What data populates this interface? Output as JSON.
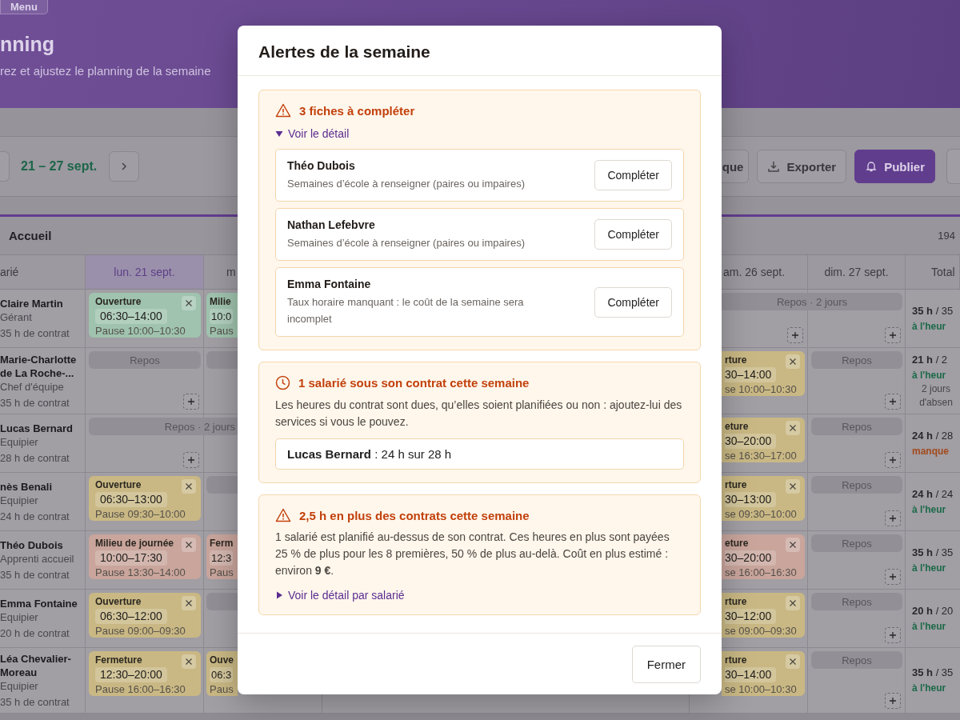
{
  "page": {
    "menu_button": "Menu",
    "title": "nning",
    "subtitle": "rez et ajustez le planning de la semaine"
  },
  "toolbar": {
    "week": "21 – 27 sept.",
    "buttons": [
      {
        "kind": "plain",
        "label": "que"
      },
      {
        "kind": "export",
        "label": "Exporter"
      },
      {
        "kind": "primary",
        "label": "Publier"
      }
    ]
  },
  "team": {
    "name": "Accueil",
    "total": "194"
  },
  "table": {
    "employee_header": "arié",
    "total_header": "Total",
    "columns": [
      {
        "label": "lun. 21 sept.",
        "selected": true
      },
      {
        "label": "m",
        "selected": false
      },
      {
        "label": "am. 26 sept.",
        "selected": false
      },
      {
        "label": "dim. 27 sept.",
        "selected": false
      }
    ],
    "rows": [
      {
        "name": "Claire Martin",
        "role": "Gérant",
        "contract": "35 h de contrat",
        "cells": [
          {
            "kind": "shift",
            "color": "#9fc3ae",
            "title": "Ouverture",
            "time": "06:30–14:00",
            "pause": "Pause 10:00–10:30"
          },
          {
            "kind": "shift",
            "color": "#9fc3ae",
            "title": "Milie",
            "time": "10:0",
            "pause": "Paus"
          },
          {
            "kind": "rest_span",
            "label": "Repos · 2 jours"
          },
          {
            "kind": "rest_cont"
          }
        ],
        "total": {
          "hours": "**35 h** / 35",
          "status": "à l'heur",
          "ok": true
        }
      },
      {
        "name": "Marie-Charlotte de La Roche-...",
        "role": "Chef d'équipe",
        "contract": "35 h de contrat",
        "cells": [
          {
            "kind": "rest",
            "label": "Repos"
          },
          {
            "kind": "blank_rest"
          },
          {
            "kind": "shift",
            "color": "#c9b884",
            "title": "rture",
            "time": "30–14:00",
            "pause": "se 10:00–10:30"
          },
          {
            "kind": "rest",
            "label": "Repos"
          }
        ],
        "total": {
          "hours": "**21 h** / 2",
          "status": "à l'heur",
          "ok": true,
          "note": "2 jours d'absen"
        }
      },
      {
        "name": "Lucas Bernard",
        "role": "Equipier",
        "contract": "28 h de contrat",
        "cells": [
          {
            "kind": "rest_span",
            "label": "Repos · 2 jours"
          },
          {
            "kind": "rest_cont"
          },
          {
            "kind": "shift",
            "color": "#c9b884",
            "title": "eture",
            "time": "30–20:00",
            "pause": "se 16:30–17:00"
          },
          {
            "kind": "rest",
            "label": "Repos"
          }
        ],
        "total": {
          "hours": "**24 h** / 28",
          "status": "manque",
          "ok": false
        }
      },
      {
        "name": "nès Benali",
        "role": "Equipier",
        "contract": "24 h de contrat",
        "cells": [
          {
            "kind": "shift",
            "color": "#c9b884",
            "title": "Ouverture",
            "time": "06:30–13:00",
            "pause": "Pause 09:30–10:00"
          },
          {
            "kind": "blank_rest"
          },
          {
            "kind": "shift",
            "color": "#c9b884",
            "title": "rture",
            "time": "30–13:00",
            "pause": "se 09:30–10:00"
          },
          {
            "kind": "rest",
            "label": "Repos"
          }
        ],
        "total": {
          "hours": "**24 h** / 24",
          "status": "à l'heur",
          "ok": true
        }
      },
      {
        "name": "Théo Dubois",
        "role": "Apprenti accueil",
        "contract": "35 h de contrat",
        "cells": [
          {
            "kind": "shift",
            "color": "#c9a59c",
            "title": "Milieu de journée",
            "time": "10:00–17:30",
            "pause": "Pause 13:30–14:00"
          },
          {
            "kind": "shift",
            "color": "#c9a59c",
            "title": "Ferm",
            "time": "12:3",
            "pause": "Paus"
          },
          {
            "kind": "shift",
            "color": "#c9a59c",
            "title": "eture",
            "time": "30–20:00",
            "pause": "se 16:00–16:30"
          },
          {
            "kind": "rest",
            "label": "Repos"
          }
        ],
        "total": {
          "hours": "**35 h** / 35",
          "status": "à l'heur",
          "ok": true
        }
      },
      {
        "name": "Emma Fontaine",
        "role": "Equipier",
        "contract": "20 h de contrat",
        "cells": [
          {
            "kind": "shift",
            "color": "#c9b884",
            "title": "Ouverture",
            "time": "06:30–12:00",
            "pause": "Pause 09:00–09:30"
          },
          {
            "kind": "blank_rest"
          },
          {
            "kind": "shift",
            "color": "#c9b884",
            "title": "rture",
            "time": "30–12:00",
            "pause": "se 09:00–09:30"
          },
          {
            "kind": "rest",
            "label": "Repos"
          }
        ],
        "total": {
          "hours": "**20 h** / 20",
          "status": "à l'heur",
          "ok": true
        }
      },
      {
        "name": "Léa Chevalier-Moreau",
        "role": "Equipier",
        "contract": "35 h de contrat",
        "cells": [
          {
            "kind": "shift",
            "color": "#c9b884",
            "title": "Fermeture",
            "time": "12:30–20:00",
            "pause": "Pause 16:00–16:30"
          },
          {
            "kind": "shift",
            "color": "#c9b884",
            "title": "Ouve",
            "time": "06:3",
            "pause": "Paus"
          },
          {
            "kind": "shift",
            "color": "#c9b884",
            "title": "rture",
            "time": "30–14:00",
            "pause": "se 10:00–10:30"
          },
          {
            "kind": "rest",
            "label": "Repos"
          }
        ],
        "total": {
          "hours": "**35 h** / 35",
          "status": "à l'heur",
          "ok": true
        }
      }
    ]
  },
  "modal": {
    "title": "Alertes de la semaine",
    "sections": [
      {
        "kind": "warning",
        "title": "3 fiches à compléter",
        "details": {
          "label": "Voir le détail",
          "expanded": true
        },
        "items": [
          {
            "name": "Théo Dubois",
            "text": "Semaines d’école à renseigner (paires ou impaires)",
            "action": "Compléter"
          },
          {
            "name": "Nathan Lefebvre",
            "text": "Semaines d’école à renseigner (paires ou impaires)",
            "action": "Compléter"
          },
          {
            "name": "Emma Fontaine",
            "text": "Taux horaire manquant : le coût de la semaine sera incomplet",
            "action": "Compléter"
          }
        ]
      },
      {
        "kind": "clock",
        "title": "1 salarié sous son contrat cette semaine",
        "text": "Les heures du contrat sont dues, qu’elles soient planifiées ou non : ajoutez-lui des services si vous le pouvez.",
        "summary": "**Lucas Bernard** : 24 h sur 28 h"
      },
      {
        "kind": "warning",
        "title": "2,5 h en plus des contrats cette semaine",
        "text": "1 salarié est planifié au-dessus de son contrat. Ces heures en plus sont payées 25 % de plus pour les 8 premières, 50 % de plus au-delà. Coût en plus estimé : environ **9 €**.",
        "details": {
          "label": "Voir le détail par salarié",
          "expanded": false
        }
      }
    ],
    "close": "Fermer"
  }
}
